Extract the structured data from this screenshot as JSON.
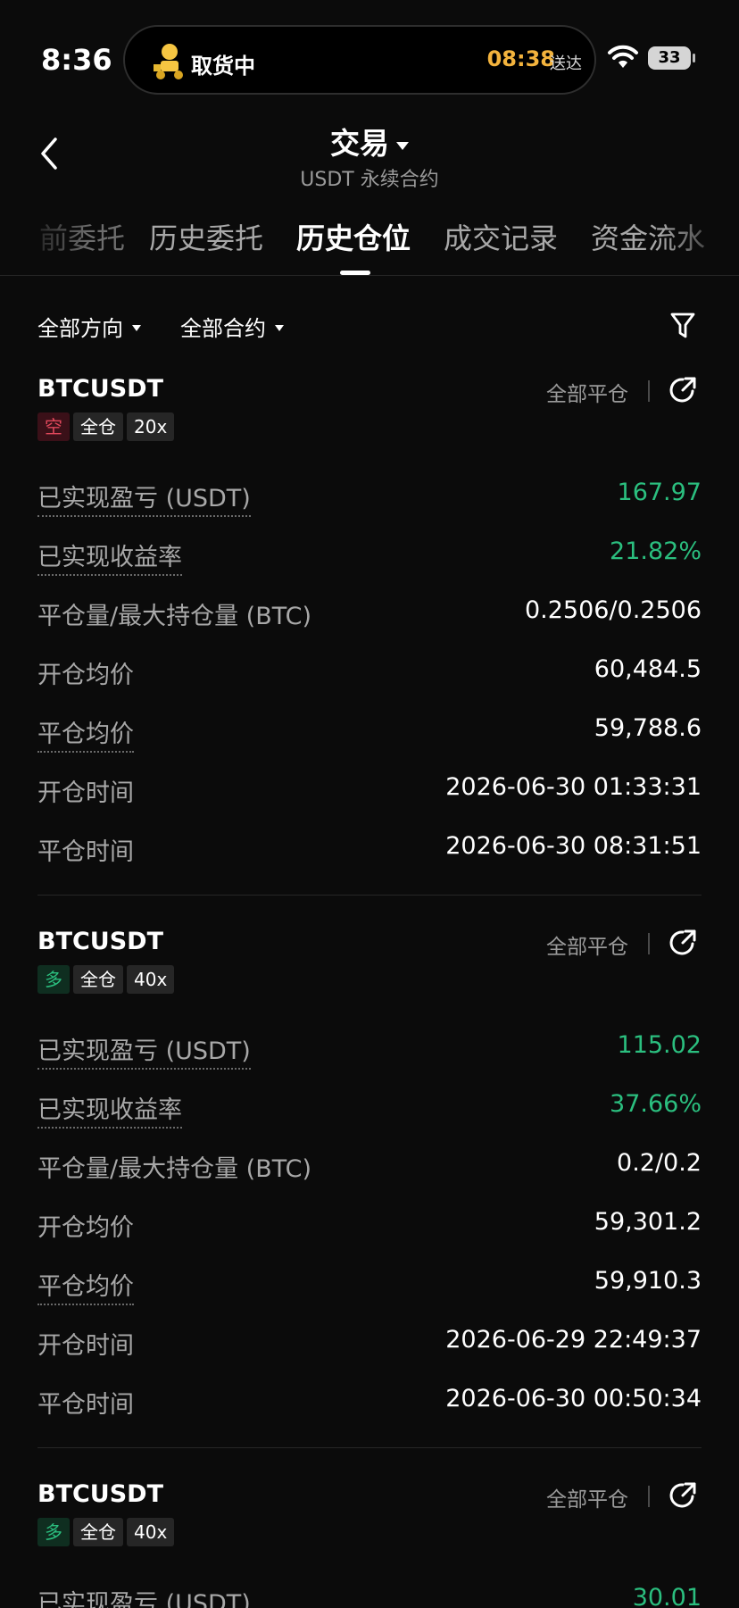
{
  "status_bar": {
    "time": "8:36",
    "live_activity": {
      "text": "取货中",
      "eta": "08:38",
      "eta_suffix": "送达"
    },
    "battery": "33"
  },
  "header": {
    "title": "交易",
    "subtitle": "USDT 永续合约"
  },
  "tabs": [
    "前委托",
    "历史委托",
    "历史仓位",
    "成交记录",
    "资金流水"
  ],
  "active_tab": "历史仓位",
  "filters": {
    "direction": "全部方向",
    "contract": "全部合约"
  },
  "colors": {
    "green": "#2bbf7f",
    "red": "#e0485b",
    "background": "#0b0b0b"
  },
  "positions": [
    {
      "symbol": "BTCUSDT",
      "close_all": "全部平仓",
      "side": "空",
      "margin_mode": "全仓",
      "leverage": "20x",
      "rows": [
        {
          "label": "已实现盈亏 (USDT)",
          "value": "167.97"
        },
        {
          "label": "已实现收益率",
          "value": "21.82%"
        },
        {
          "label": "平仓量/最大持仓量 (BTC)",
          "value": "0.2506/0.2506"
        },
        {
          "label": "开仓均价",
          "value": "60,484.5"
        },
        {
          "label": "平仓均价",
          "value": "59,788.6"
        },
        {
          "label": "开仓时间",
          "value": "2026-06-30 01:33:31"
        },
        {
          "label": "平仓时间",
          "value": "2026-06-30 08:31:51"
        }
      ]
    },
    {
      "symbol": "BTCUSDT",
      "close_all": "全部平仓",
      "side": "多",
      "margin_mode": "全仓",
      "leverage": "40x",
      "rows": [
        {
          "label": "已实现盈亏 (USDT)",
          "value": "115.02"
        },
        {
          "label": "已实现收益率",
          "value": "37.66%"
        },
        {
          "label": "平仓量/最大持仓量 (BTC)",
          "value": "0.2/0.2"
        },
        {
          "label": "开仓均价",
          "value": "59,301.2"
        },
        {
          "label": "平仓均价",
          "value": "59,910.3"
        },
        {
          "label": "开仓时间",
          "value": "2026-06-29 22:49:37"
        },
        {
          "label": "平仓时间",
          "value": "2026-06-30 00:50:34"
        }
      ]
    },
    {
      "symbol": "BTCUSDT",
      "close_all": "全部平仓",
      "side": "多",
      "margin_mode": "全仓",
      "leverage": "40x",
      "rows": [
        {
          "label": "已实现盈亏 (USDT)",
          "value": "30.01"
        }
      ]
    }
  ]
}
